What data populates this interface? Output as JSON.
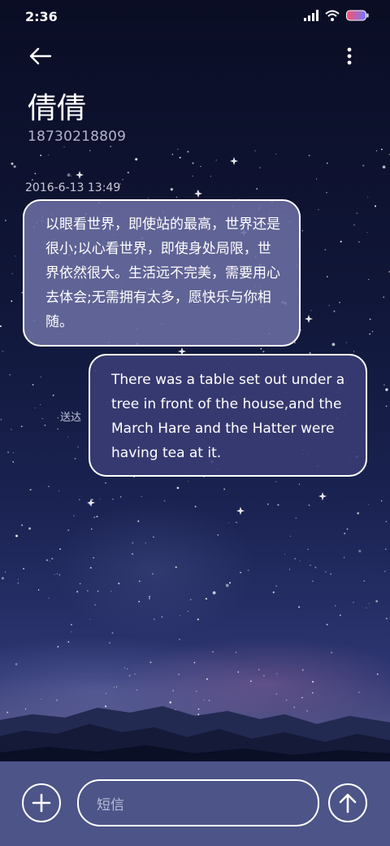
{
  "status_bar": {
    "time": "2:36"
  },
  "header": {
    "back_icon": "arrow-left-icon",
    "more_icon": "vertical-dots-icon",
    "contact_name": "倩倩",
    "contact_phone": "18730218809"
  },
  "conversation": {
    "timestamp": "2016-6-13 13:49",
    "messages": [
      {
        "direction": "incoming",
        "text": "以眼看世界，即使站的最高，世界还是很小;以心看世界，即使身处局限，世界依然很大。生活远不完美，需要用心去体会;无需拥有太多，愿快乐与你相随。"
      },
      {
        "direction": "outgoing",
        "text": "There was a table set out under a tree in front of the house,and the March Hare and the Hatter were having tea at it.",
        "status": "送达"
      }
    ]
  },
  "input_bar": {
    "add_icon": "plus-icon",
    "placeholder": "短信",
    "send_icon": "arrow-up-icon"
  },
  "colors": {
    "input_bar_bg": "#4c5488",
    "incoming_bubble": "#696ca0",
    "outgoing_bubble": "#3a3c73",
    "bubble_border": "#ffffff"
  }
}
